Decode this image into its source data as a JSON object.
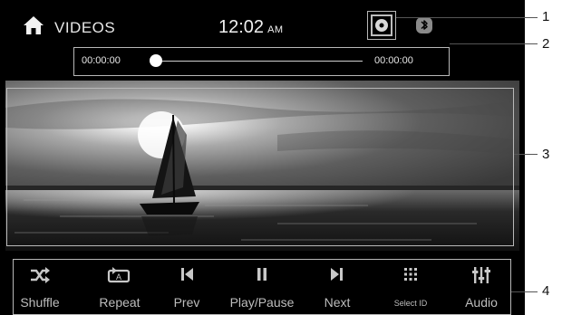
{
  "status_bar": {
    "icon_home": "home-icon",
    "title": "VIDEOS",
    "time": "12:02",
    "ampm": "AM",
    "icon_disc": "disc-icon",
    "icon_bluetooth": "bluetooth-icon"
  },
  "progress": {
    "elapsed": "00:00:00",
    "total": "00:00:00",
    "fraction": 0
  },
  "video": {
    "scene": "sailboat-sunset-photo"
  },
  "controls": [
    {
      "label": "Shuffle",
      "icon": "shuffle-icon"
    },
    {
      "label": "Repeat",
      "icon": "repeat-icon"
    },
    {
      "label": "Prev",
      "icon": "previous-icon"
    },
    {
      "label": "Play/Pause",
      "icon": "pause-icon"
    },
    {
      "label": "Next",
      "icon": "next-icon"
    },
    {
      "label": "Select ID",
      "icon": "grid-icon"
    },
    {
      "label": "Audio",
      "icon": "equalizer-icon"
    }
  ],
  "callouts": [
    "1",
    "2",
    "3",
    "4"
  ],
  "colors": {
    "screen_bg": "#000000",
    "text": "#e8e8e8",
    "callout_border": "#b8b8b8"
  }
}
